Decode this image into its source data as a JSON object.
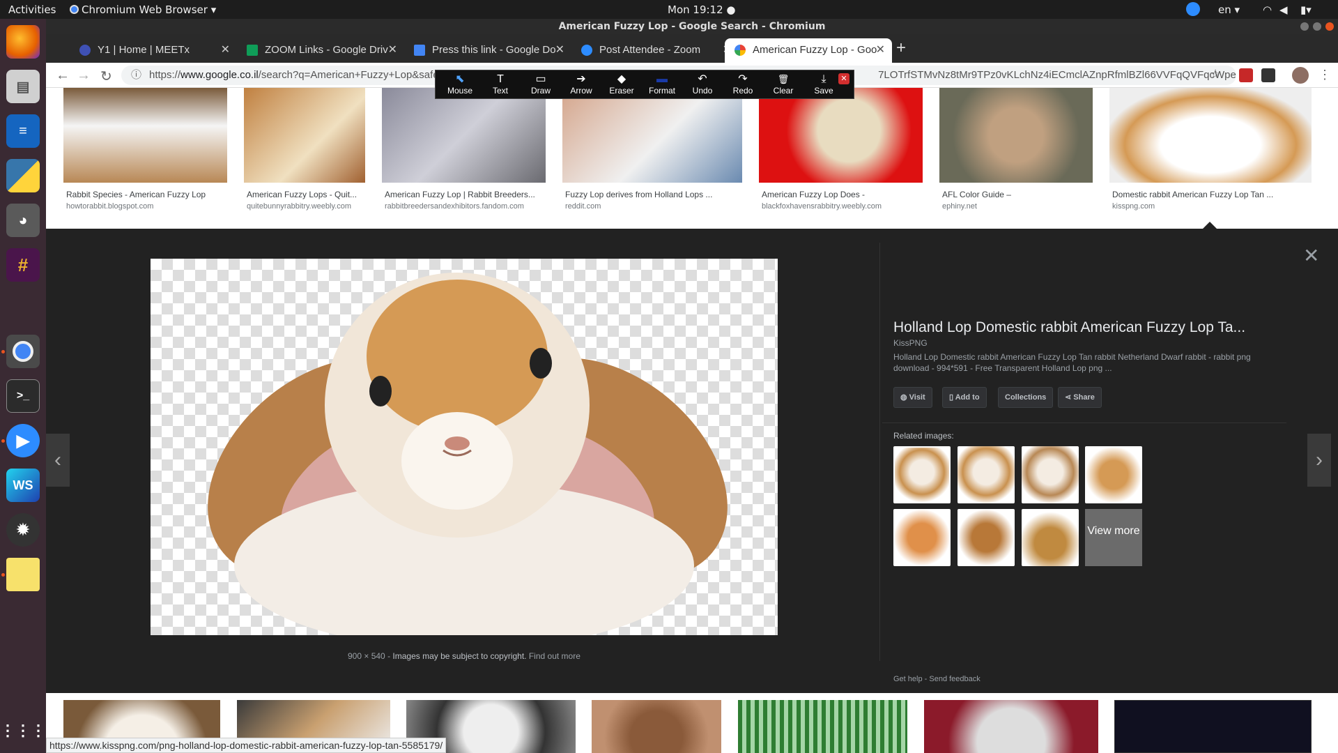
{
  "topbar": {
    "activities": "Activities",
    "app_menu": "Chromium Web Browser",
    "clock": "Mon 19:12",
    "lang": "en"
  },
  "window": {
    "title": "American Fuzzy Lop - Google Search - Chromium"
  },
  "tabs": [
    {
      "label": "Y1 | Home | MEETx",
      "color": "#3f51b5"
    },
    {
      "label": "ZOOM Links - Google Driv",
      "color": "#0f9d58"
    },
    {
      "label": "Press this link - Google Do",
      "color": "#4285f4"
    },
    {
      "label": "Post Attendee - Zoom",
      "color": "#2d8cff"
    },
    {
      "label": "American Fuzzy Lop - Goo",
      "color": "#ea4335"
    }
  ],
  "url": {
    "scheme": "https://",
    "host": "www.google.co.il",
    "path": "/search?q=American+Fuzzy+Lop&safe=st",
    "tail": "7LOTrfSTMvNz8tMr9TPz0vKLchNz4iECmclAZnpRfmlBZl66VVFqQVFqcWpe..."
  },
  "annotation_tools": [
    {
      "label": "Mouse",
      "glyph": "⬉"
    },
    {
      "label": "Text",
      "glyph": "T"
    },
    {
      "label": "Draw",
      "glyph": "▭"
    },
    {
      "label": "Arrow",
      "glyph": "➔"
    },
    {
      "label": "Eraser",
      "glyph": "◆"
    },
    {
      "label": "Format",
      "glyph": "▬"
    },
    {
      "label": "Undo",
      "glyph": "↶"
    },
    {
      "label": "Redo",
      "glyph": "↷"
    },
    {
      "label": "Clear",
      "glyph": "🗑"
    },
    {
      "label": "Save",
      "glyph": "⤓"
    }
  ],
  "results_top": [
    {
      "caption": "Rabbit Species - American Fuzzy Lop",
      "domain": "howtorabbit.blogspot.com"
    },
    {
      "caption": "American Fuzzy Lops - Quit...",
      "domain": "quitebunnyrabbitry.weebly.com"
    },
    {
      "caption": "American Fuzzy Lop | Rabbit Breeders...",
      "domain": "rabbitbreedersandexhibitors.fandom.com"
    },
    {
      "caption": "Fuzzy Lop derives from Holland Lops ...",
      "domain": "reddit.com"
    },
    {
      "caption": "American Fuzzy Lop Does -",
      "domain": "blackfoxhavensrabbitry.weebly.com"
    },
    {
      "caption": "AFL Color Guide –",
      "domain": "ephiny.net"
    },
    {
      "caption": "Domestic rabbit American Fuzzy Lop Tan ...",
      "domain": "kisspng.com"
    }
  ],
  "preview": {
    "dimensions": "900 × 540",
    "separator": "-",
    "copyright": "Images may be subject to copyright.",
    "find_out_more": "Find out more",
    "title": "Holland Lop Domestic rabbit American Fuzzy Lop Ta...",
    "source": "KissPNG",
    "description": "Holland Lop Domestic rabbit American Fuzzy Lop Tan rabbit Netherland Dwarf rabbit - rabbit png download - 994*591 - Free Transparent Holland Lop png ...",
    "actions": {
      "visit": "Visit",
      "add_to": "Add to",
      "collections": "Collections",
      "share": "Share"
    },
    "related_label": "Related images:",
    "view_more": "View more",
    "get_help": "Get help",
    "send_feedback": "Send feedback"
  },
  "status_url": "https://www.kisspng.com/png-holland-lop-domestic-rabbit-american-fuzzy-lop-tan-5585179/"
}
